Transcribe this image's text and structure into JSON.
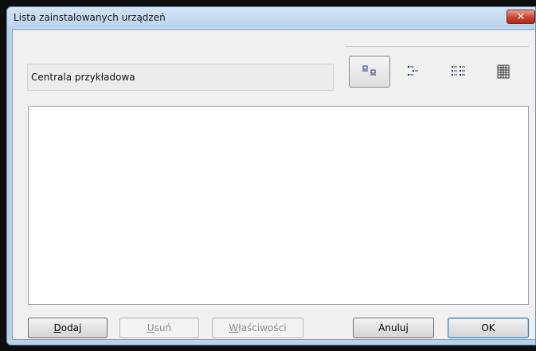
{
  "window": {
    "title": "Lista zainstalowanych urządzeń",
    "close_glyph": "✕"
  },
  "device": {
    "name": "Centrala przykładowa"
  },
  "view_buttons": [
    {
      "name": "view-large-icons",
      "icon": "large-icons-icon",
      "active": true
    },
    {
      "name": "view-small-icons",
      "icon": "small-icons-icon",
      "active": false
    },
    {
      "name": "view-list",
      "icon": "list-view-icon",
      "active": false
    },
    {
      "name": "view-details",
      "icon": "details-view-icon",
      "active": false
    }
  ],
  "device_list": {
    "items": []
  },
  "buttons": {
    "add": {
      "mnemonic": "D",
      "rest": "odaj"
    },
    "remove": {
      "mnemonic": "U",
      "rest": "suń"
    },
    "properties": {
      "mnemonic": "W",
      "rest": "łaściwości"
    },
    "cancel": "Anuluj",
    "ok": "OK"
  },
  "colors": {
    "frame": "#b9d1ea",
    "close_button": "#c7432f",
    "dialog_background": "#f0f0f0",
    "default_button_border": "#3c7fb1"
  }
}
